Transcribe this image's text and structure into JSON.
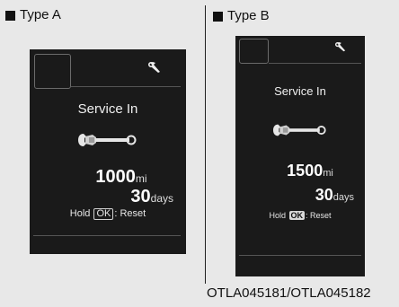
{
  "type_a": {
    "label": "Type A",
    "title": "Service In",
    "distance_value": "1000",
    "distance_unit": "mi",
    "days_value": "30",
    "days_unit": "days",
    "hold_prefix": "Hold",
    "ok_label": "OK",
    "hold_suffix": ": Reset"
  },
  "type_b": {
    "label": "Type B",
    "title": "Service In",
    "distance_value": "1500",
    "distance_unit": "mi",
    "days_value": "30",
    "days_unit": "days",
    "hold_prefix": "Hold",
    "ok_label": "OK",
    "hold_suffix": ": Reset"
  },
  "caption": "OTLA045181/OTLA045182",
  "icons": [
    "wrench-icon",
    "square-bullet-icon"
  ],
  "colors": {
    "background": "#e8e8e8",
    "screen": "#1a1a1a",
    "screen_text": "#eaeaea"
  }
}
